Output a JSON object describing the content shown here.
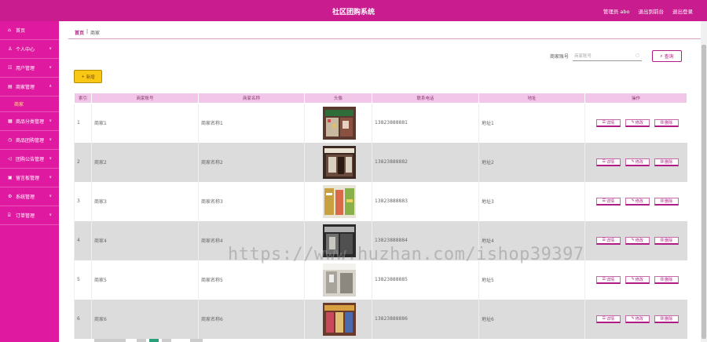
{
  "header": {
    "title": "社区团购系统",
    "admin": "管理员 abo",
    "back_to_front": "退出到前台",
    "logout": "退出登录"
  },
  "sidebar": {
    "items": [
      {
        "icon": "home-icon",
        "label": "首页",
        "has_chevron": false
      },
      {
        "icon": "user-icon",
        "label": "个人中心",
        "has_chevron": true
      },
      {
        "icon": "users-icon",
        "label": "用户管理",
        "has_chevron": true
      },
      {
        "icon": "store-icon",
        "label": "商家管理",
        "has_chevron": true,
        "expanded": true,
        "sub": [
          "商家"
        ]
      },
      {
        "icon": "tag-icon",
        "label": "商品分类管理",
        "has_chevron": true
      },
      {
        "icon": "clock-icon",
        "label": "商品团购管理",
        "has_chevron": true
      },
      {
        "icon": "megaphone-icon",
        "label": "团购公告管理",
        "has_chevron": true
      },
      {
        "icon": "chat-icon",
        "label": "留言板管理",
        "has_chevron": true
      },
      {
        "icon": "gear-icon",
        "label": "系统管理",
        "has_chevron": true
      },
      {
        "icon": "order-icon",
        "label": "订单管理",
        "has_chevron": true
      }
    ]
  },
  "breadcrumb": {
    "home": "首页",
    "sep": "|",
    "current": "商家"
  },
  "search": {
    "label": "商家账号",
    "placeholder": "商家账号",
    "button": "查询"
  },
  "toolbar": {
    "add_label": "新增"
  },
  "table": {
    "columns": [
      "索引",
      "商家账号",
      "商家名称",
      "头像",
      "联系电话",
      "地址",
      "操作"
    ],
    "rows": [
      {
        "index": "1",
        "account": "商家1",
        "name": "商家名称1",
        "phone": "13823888881",
        "address": "地址1"
      },
      {
        "index": "2",
        "account": "商家2",
        "name": "商家名称2",
        "phone": "13823888882",
        "address": "地址2"
      },
      {
        "index": "3",
        "account": "商家3",
        "name": "商家名称3",
        "phone": "13823888883",
        "address": "地址3"
      },
      {
        "index": "4",
        "account": "商家4",
        "name": "商家名称4",
        "phone": "13823888884",
        "address": "地址4"
      },
      {
        "index": "5",
        "account": "商家5",
        "name": "商家名称5",
        "phone": "13823888885",
        "address": "地址5"
      },
      {
        "index": "6",
        "account": "商家6",
        "name": "商家名称6",
        "phone": "13823888886",
        "address": "地址6"
      }
    ],
    "ops": {
      "detail": "详情",
      "edit": "修改",
      "delete": "删除"
    }
  },
  "watermark": "https://www.huzhan.com/ishop39397",
  "colors": {
    "accent": "#c81c8f",
    "sidebar": "#e01aa0",
    "header_row": "#f2c6e9",
    "add_button": "#f8c814"
  }
}
